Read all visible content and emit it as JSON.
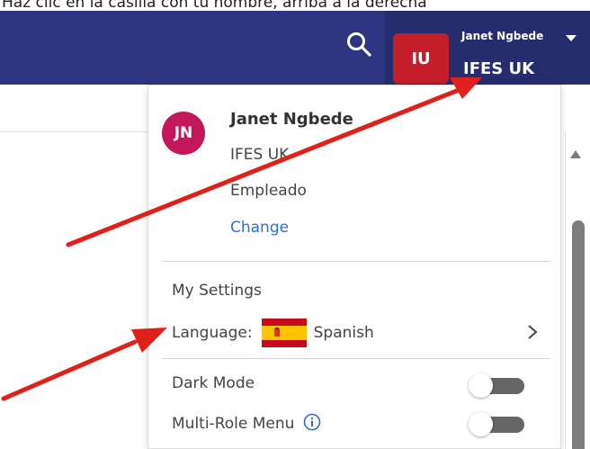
{
  "instruction_text": "Haz clic en la casilla con tu nombre, arriba a la derecha",
  "header": {
    "avatar_initials": "IU",
    "user_name": "Janet Ngbede",
    "org": "IFES UK",
    "search_icon": "search-icon",
    "caret_icon": "caret-down-icon"
  },
  "profile": {
    "initials": "JN",
    "name": "Janet Ngbede",
    "org": "IFES UK",
    "role": "Empleado",
    "change_label": "Change"
  },
  "menu": {
    "settings_label": "My Settings",
    "language_label": "Language:",
    "language_value": "Spanish",
    "language_flag_icon": "spain-flag-icon",
    "dark_mode_label": "Dark Mode",
    "dark_mode_on": false,
    "multi_role_label": "Multi-Role Menu",
    "multi_role_on": false
  },
  "colors": {
    "header_bg": "#2d3580",
    "avatar_red": "#c41e2a",
    "profile_avatar": "#c2185b",
    "link_blue": "#2f6fcc",
    "annotation_arrow": "#e0201b"
  }
}
